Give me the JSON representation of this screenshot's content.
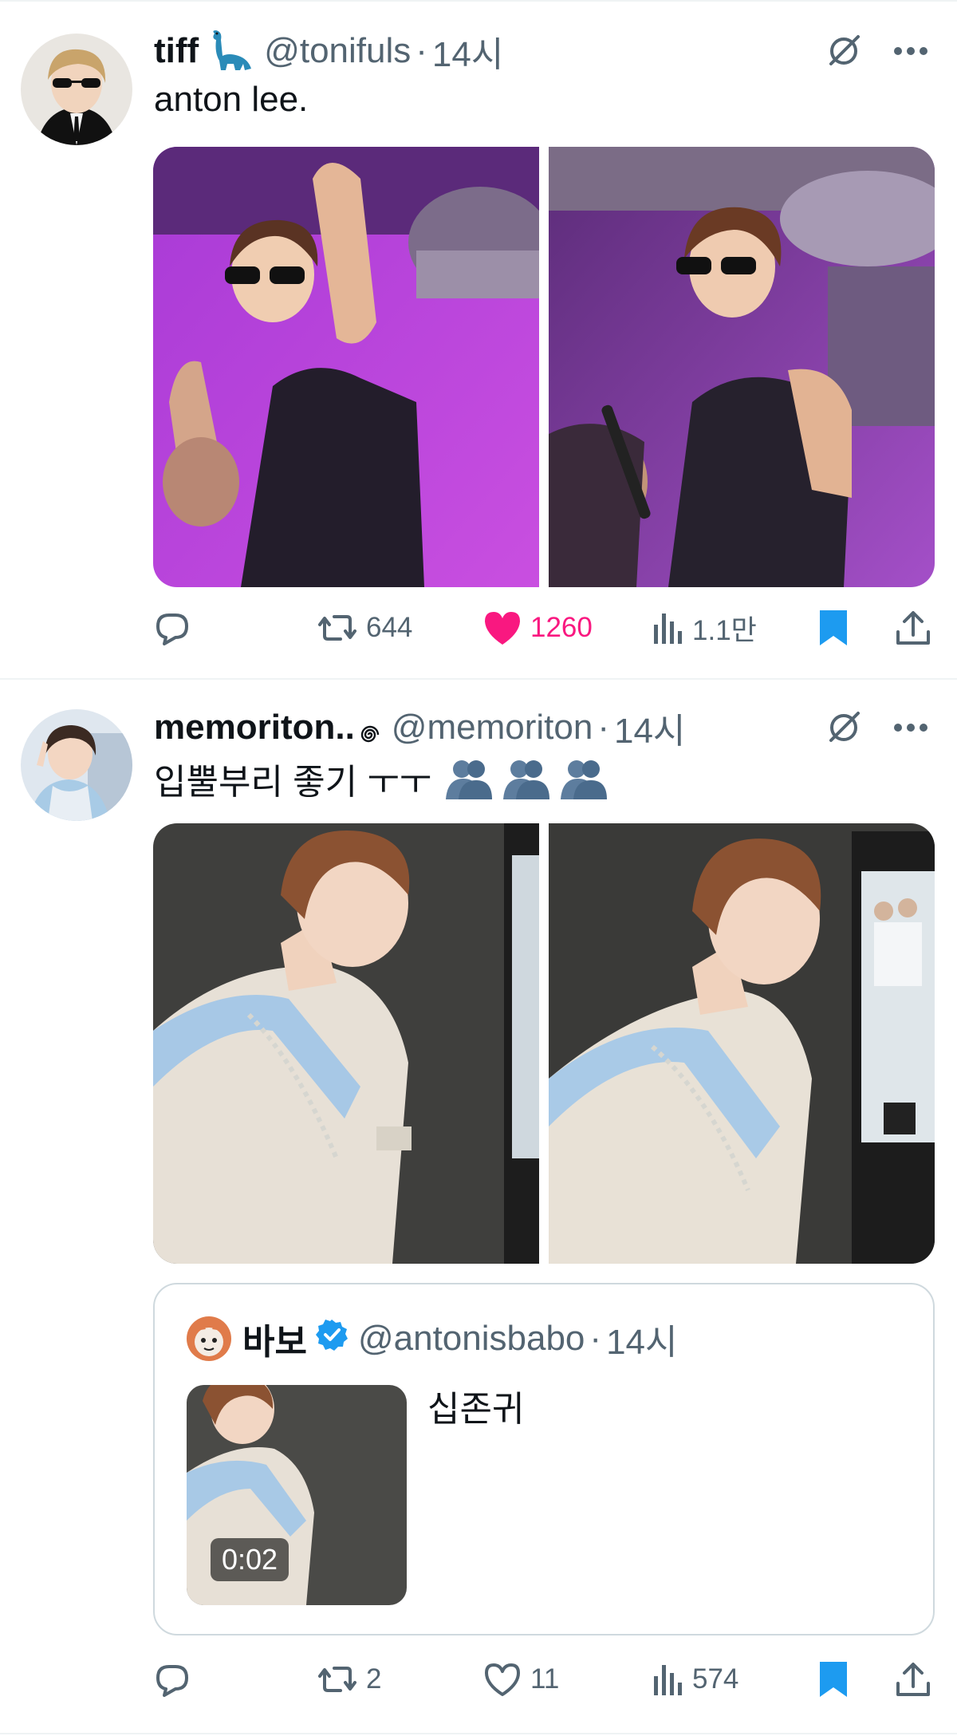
{
  "tweets": [
    {
      "name": "tiff",
      "name_emoji": "dinosaur-emoji",
      "handle": "@tonifuls",
      "time": "14시",
      "text": "anton lee.",
      "stats": {
        "replies": "",
        "retweets": "644",
        "likes": "1260",
        "views": "1.1만"
      },
      "liked": true,
      "bookmarked": true
    },
    {
      "name": "memoriton..",
      "name_emoji": "swirl-emoji",
      "handle": "@memoriton",
      "time": "14시",
      "text": "입뿔부리 좋기 ㅜㅜ",
      "text_emoji": "hugging-people-emoji x3",
      "quote": {
        "name": "바보",
        "verified": true,
        "handle": "@antonisbabo",
        "time": "14시",
        "text": "십존귀",
        "video_duration": "0:02"
      },
      "stats": {
        "replies": "",
        "retweets": "2",
        "likes": "11",
        "views": "574"
      },
      "liked": false,
      "bookmarked": true
    }
  ],
  "colors": {
    "text": "#0f1419",
    "secondary": "#536471",
    "like": "#f91880",
    "bookmark": "#1d9bf0",
    "divider": "#eff3f4",
    "border": "#cfd9de"
  },
  "icons": [
    "reply-icon",
    "retweet-icon",
    "like-icon",
    "views-icon",
    "bookmark-icon",
    "share-icon",
    "grok-icon",
    "more-icon",
    "verified-icon"
  ]
}
